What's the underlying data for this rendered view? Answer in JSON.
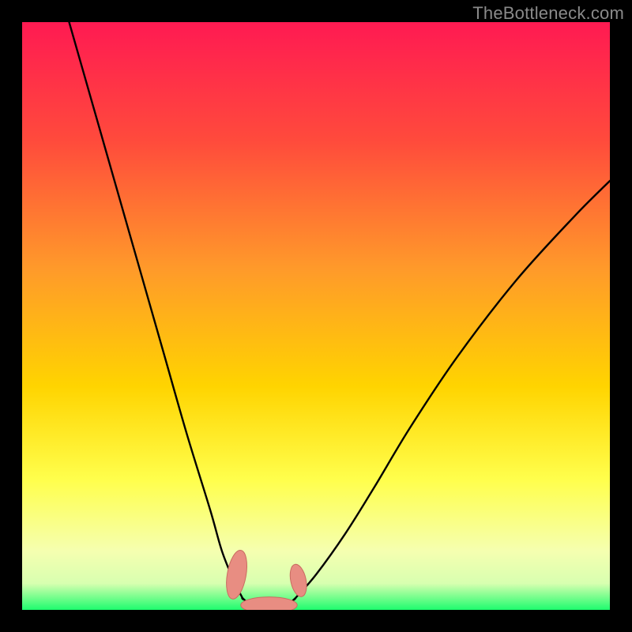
{
  "watermark": "TheBottleneck.com",
  "colors": {
    "bg": "#000000",
    "grad_top": "#ff1a52",
    "grad_mid1": "#ff7b2e",
    "grad_mid2": "#ffd400",
    "grad_mid3": "#ffff4d",
    "grad_low": "#f5ffb0",
    "grad_bottom": "#1efc6e",
    "curve": "#000000",
    "marker_fill": "#e88d82",
    "marker_stroke": "#c96b60"
  },
  "chart_data": {
    "type": "line",
    "title": "",
    "xlabel": "",
    "ylabel": "",
    "xlim": [
      0,
      100
    ],
    "ylim": [
      0,
      100
    ],
    "series": [
      {
        "name": "left-branch",
        "x": [
          8,
          12,
          16,
          20,
          24,
          28,
          32,
          34,
          36,
          37.5
        ],
        "y": [
          100,
          86,
          72,
          58,
          44,
          30,
          17,
          10,
          5,
          2
        ]
      },
      {
        "name": "valley",
        "x": [
          37.5,
          39,
          41,
          43,
          45,
          46.5
        ],
        "y": [
          2,
          0.8,
          0.4,
          0.4,
          0.8,
          2
        ]
      },
      {
        "name": "right-branch",
        "x": [
          46.5,
          50,
          55,
          60,
          66,
          74,
          84,
          94,
          100
        ],
        "y": [
          2,
          6,
          13,
          21,
          31,
          43,
          56,
          67,
          73
        ]
      }
    ],
    "markers": [
      {
        "name": "left-cluster",
        "cx": 36.5,
        "cy": 6,
        "rx": 1.6,
        "ry": 4.2,
        "rot": 10
      },
      {
        "name": "right-cluster",
        "cx": 47.0,
        "cy": 5,
        "rx": 1.3,
        "ry": 2.8,
        "rot": -12
      },
      {
        "name": "bottom-blob",
        "cx": 42.0,
        "cy": 0.8,
        "rx": 4.8,
        "ry": 1.4,
        "rot": 0
      }
    ],
    "gradient_stops": [
      {
        "offset": 0.0,
        "color": "#ff1a52"
      },
      {
        "offset": 0.2,
        "color": "#ff4a3c"
      },
      {
        "offset": 0.42,
        "color": "#ff9a2a"
      },
      {
        "offset": 0.62,
        "color": "#ffd400"
      },
      {
        "offset": 0.78,
        "color": "#ffff4d"
      },
      {
        "offset": 0.9,
        "color": "#f5ffb0"
      },
      {
        "offset": 0.955,
        "color": "#d8ffb0"
      },
      {
        "offset": 1.0,
        "color": "#1efc6e"
      }
    ]
  }
}
